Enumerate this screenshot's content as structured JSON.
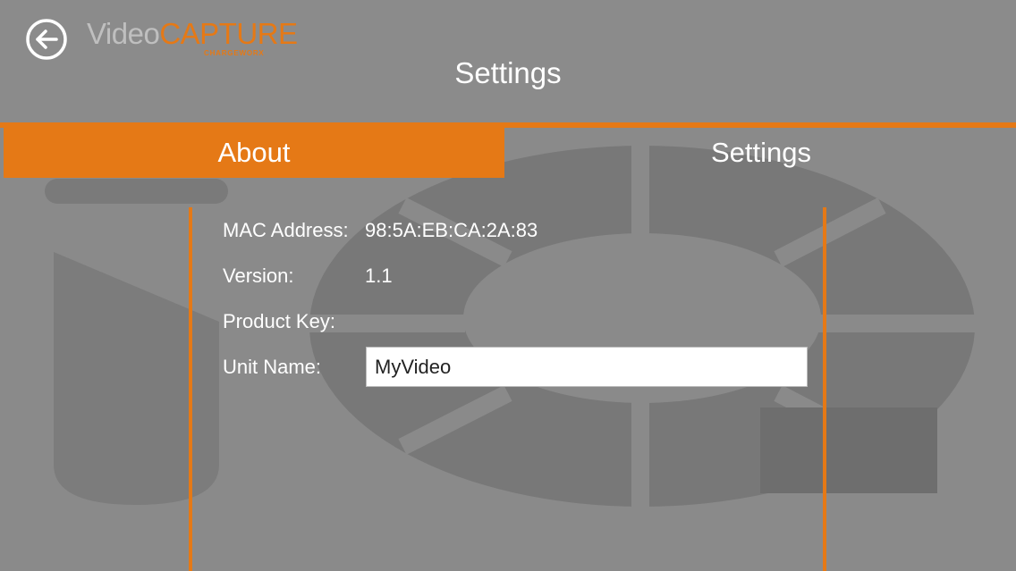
{
  "header": {
    "back_icon": "back-arrow-icon",
    "logo_video": "Video",
    "logo_capture": "CAPTURE",
    "logo_sub": "CHARGEWORX",
    "title": "Settings"
  },
  "tabs": [
    {
      "label": "About",
      "selected": true
    },
    {
      "label": "Settings",
      "selected": false
    }
  ],
  "about": {
    "mac_label": "MAC Address:",
    "mac_value": "98:5A:EB:CA:2A:83",
    "version_label": "Version:",
    "version_value": "1.1",
    "product_key_label": "Product Key:",
    "product_key_value": "",
    "unit_name_label": "Unit Name:",
    "unit_name_value": "MyVideo"
  },
  "colors": {
    "accent": "#e57916",
    "background": "#8a8a8a",
    "text": "#ffffff"
  }
}
